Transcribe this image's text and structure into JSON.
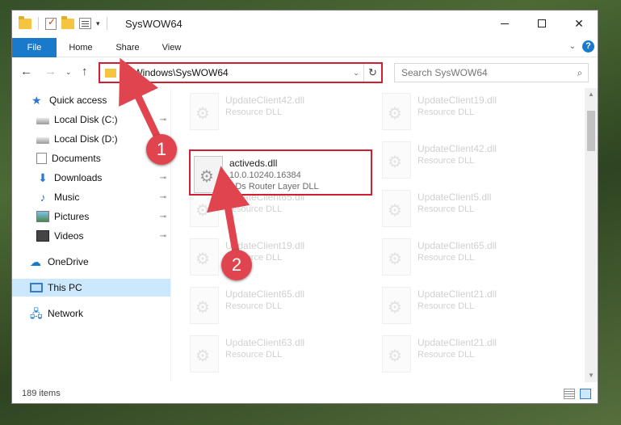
{
  "window": {
    "title": "SysWOW64",
    "qat_dropdown": "▾"
  },
  "controls": {
    "minimize": "",
    "maximize": "",
    "close": "✕"
  },
  "ribbon": {
    "tabs": [
      "File",
      "Home",
      "Share",
      "View"
    ],
    "expand_glyph": "⌄",
    "help_glyph": "?"
  },
  "nav": {
    "back": "←",
    "forward": "→",
    "recent": "⌄",
    "up": "↑"
  },
  "address": {
    "path": "C:\\Windows\\SysWOW64",
    "dropdown": "⌄",
    "refresh": "↻"
  },
  "search": {
    "placeholder": "Search SysWOW64",
    "icon": "⌕"
  },
  "sidebar": {
    "items": [
      {
        "label": "Quick access",
        "icon": "star-icon",
        "pinned": false
      },
      {
        "label": "Local Disk (C:)",
        "icon": "disk-icon",
        "pinned": true
      },
      {
        "label": "Local Disk (D:)",
        "icon": "disk-icon",
        "pinned": false
      },
      {
        "label": "Documents",
        "icon": "documents-icon",
        "pinned": true
      },
      {
        "label": "Downloads",
        "icon": "download-icon",
        "pinned": true
      },
      {
        "label": "Music",
        "icon": "music-icon",
        "pinned": true
      },
      {
        "label": "Pictures",
        "icon": "pictures-icon",
        "pinned": true
      },
      {
        "label": "Videos",
        "icon": "videos-icon",
        "pinned": true
      },
      {
        "label": "OneDrive",
        "icon": "cloud-icon",
        "pinned": false
      },
      {
        "label": "This PC",
        "icon": "computer-icon",
        "pinned": false,
        "selected": true
      },
      {
        "label": "Network",
        "icon": "network-icon",
        "pinned": false
      }
    ],
    "pin_glyph": "📌"
  },
  "files": {
    "highlighted": {
      "name": "activeds.dll",
      "line1": "10.0.10240.16384",
      "line2": "ADs Router Layer DLL"
    },
    "left_column": [
      {
        "name": "UpdateClient42.dll",
        "line1": "Resource DLL"
      },
      {
        "name": "UpdateClient65.dll",
        "line1": "Resource DLL"
      },
      {
        "name": "UpdateClient19.dll",
        "line1": "Resource DLL"
      },
      {
        "name": "UpdateClient65.dll",
        "line1": "Resource DLL"
      },
      {
        "name": "UpdateClient63.dll",
        "line1": "Resource DLL"
      }
    ],
    "right_column": [
      {
        "name": "UpdateClient19.dll",
        "line1": "Resource DLL"
      },
      {
        "name": "UpdateClient42.dll",
        "line1": "Resource DLL"
      },
      {
        "name": "UpdateClient5.dll",
        "line1": "Resource DLL"
      },
      {
        "name": "UpdateClient65.dll",
        "line1": "Resource DLL"
      },
      {
        "name": "UpdateClient21.dll",
        "line1": "Resource DLL"
      },
      {
        "name": "UpdateClient21.dll",
        "line1": "Resource DLL"
      }
    ]
  },
  "status": {
    "count": "189 items"
  },
  "scroll": {
    "up": "▲",
    "down": "▼"
  },
  "callouts": [
    "1",
    "2"
  ],
  "colors": {
    "accent": "#1979ca",
    "highlight_border": "#d02030",
    "callout": "#e0454f"
  }
}
